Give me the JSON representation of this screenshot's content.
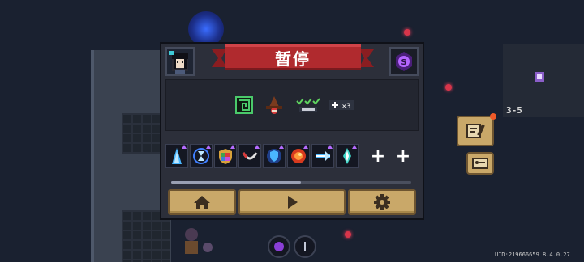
{
  "pause_dialog": {
    "title": "暂停",
    "colors": {
      "banner": "#b02a2e",
      "panel": "#2c2f3a",
      "button": "#c9a869",
      "button_border": "#6e5530"
    },
    "effect_icons": [
      "maze-icon",
      "wizard-hat-icon",
      "checkmarks-icon",
      "gamepad-x3-icon"
    ],
    "effect_badge": "×3",
    "buff_icons": [
      "ice-spike-buff-icon",
      "hourglass-buff-icon",
      "elemental-shield-buff-icon",
      "fang-buff-icon",
      "blue-shield-buff-icon",
      "fire-swirl-buff-icon",
      "energy-beam-buff-icon",
      "crystal-spear-buff-icon"
    ],
    "add_slots": [
      "+",
      "+"
    ],
    "buttons": [
      "home-icon",
      "play-icon",
      "settings-gear-icon"
    ]
  },
  "hud": {
    "level": "3-5",
    "uid": "UID:219666659 8.4.0.27"
  }
}
